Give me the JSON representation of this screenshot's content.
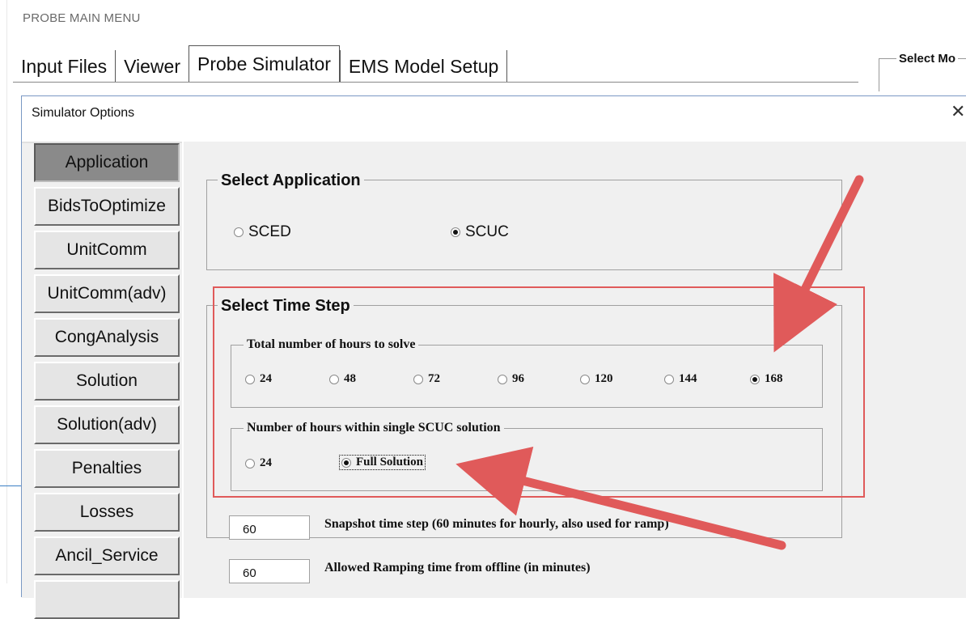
{
  "app": {
    "title": "PROBE MAIN MENU"
  },
  "main_tabs": [
    {
      "label": "Input Files"
    },
    {
      "label": "Viewer"
    },
    {
      "label": "Probe Simulator"
    },
    {
      "label": "EMS Model Setup"
    }
  ],
  "right_group": {
    "title": "Select Mo"
  },
  "dialog": {
    "title": "Simulator Options",
    "close_icon": "close-icon"
  },
  "side_buttons": [
    {
      "label": "Application",
      "active": true
    },
    {
      "label": "BidsToOptimize"
    },
    {
      "label": "UnitComm"
    },
    {
      "label": "UnitComm(adv)"
    },
    {
      "label": "CongAnalysis"
    },
    {
      "label": "Solution"
    },
    {
      "label": "Solution(adv)"
    },
    {
      "label": "Penalties"
    },
    {
      "label": "Losses"
    },
    {
      "label": "Ancil_Service"
    }
  ],
  "select_application": {
    "title": "Select Application",
    "options": [
      {
        "label": "SCED",
        "selected": false
      },
      {
        "label": "SCUC",
        "selected": true
      }
    ]
  },
  "select_time_step": {
    "title": "Select Time Step",
    "total_hours": {
      "title": "Total number of hours to solve",
      "options": [
        {
          "label": "24",
          "selected": false
        },
        {
          "label": "48",
          "selected": false
        },
        {
          "label": "72",
          "selected": false
        },
        {
          "label": "96",
          "selected": false
        },
        {
          "label": "120",
          "selected": false
        },
        {
          "label": "144",
          "selected": false
        },
        {
          "label": "168",
          "selected": true
        }
      ]
    },
    "single_solution": {
      "title": "Number of hours within single SCUC solution",
      "options": [
        {
          "label": "24",
          "selected": false
        },
        {
          "label": "Full Solution",
          "selected": true
        }
      ]
    }
  },
  "fields": [
    {
      "value": "60",
      "label": "Snapshot time step (60 minutes for hourly, also used for ramp)"
    },
    {
      "value": "60",
      "label": "Allowed Ramping time from offline (in minutes)"
    }
  ],
  "colors": {
    "annotation": "#e05a5a",
    "active_button": "#8a8a8a",
    "panel": "#f0f0f0"
  }
}
